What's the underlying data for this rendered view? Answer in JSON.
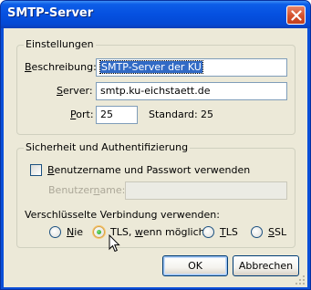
{
  "window": {
    "title": "SMTP-Server",
    "close_icon": "close-icon"
  },
  "settings": {
    "legend": "Einstellungen",
    "description": {
      "label_mnemonic": "B",
      "label_rest": "eschreibung:",
      "value": "SMTP-Server der KU"
    },
    "server": {
      "label_mnemonic": "S",
      "label_rest": "erver:",
      "value": "smtp.ku-eichstaett.de"
    },
    "port": {
      "label_mnemonic": "P",
      "label_rest": "ort:",
      "value": "25",
      "standard_label": "Standard:",
      "standard_value": "25"
    }
  },
  "security": {
    "legend": "Sicherheit und Authentifizierung",
    "auth_checkbox": {
      "label_mnemonic": "B",
      "label_rest": "enutzername und Passwort verwenden",
      "checked": false
    },
    "username": {
      "label_pre": "Benutzer",
      "label_mnemonic": "n",
      "label_post": "ame:",
      "value": ""
    },
    "encryption_label": "Verschlüsselte Verbindung verwenden:",
    "options": [
      {
        "pre": "",
        "mnemonic": "N",
        "post": "ie",
        "checked": false
      },
      {
        "pre": "TLS, ",
        "mnemonic": "w",
        "post": "enn möglich",
        "checked": true
      },
      {
        "pre": "",
        "mnemonic": "T",
        "post": "LS",
        "checked": false
      },
      {
        "pre": "",
        "mnemonic": "S",
        "post": "SL",
        "checked": false
      }
    ]
  },
  "buttons": {
    "ok": "OK",
    "cancel": "Abbrechen"
  },
  "colors": {
    "title_bar": "#0550e0",
    "dialog_bg": "#ece9d8",
    "selection": "#316ac5"
  }
}
